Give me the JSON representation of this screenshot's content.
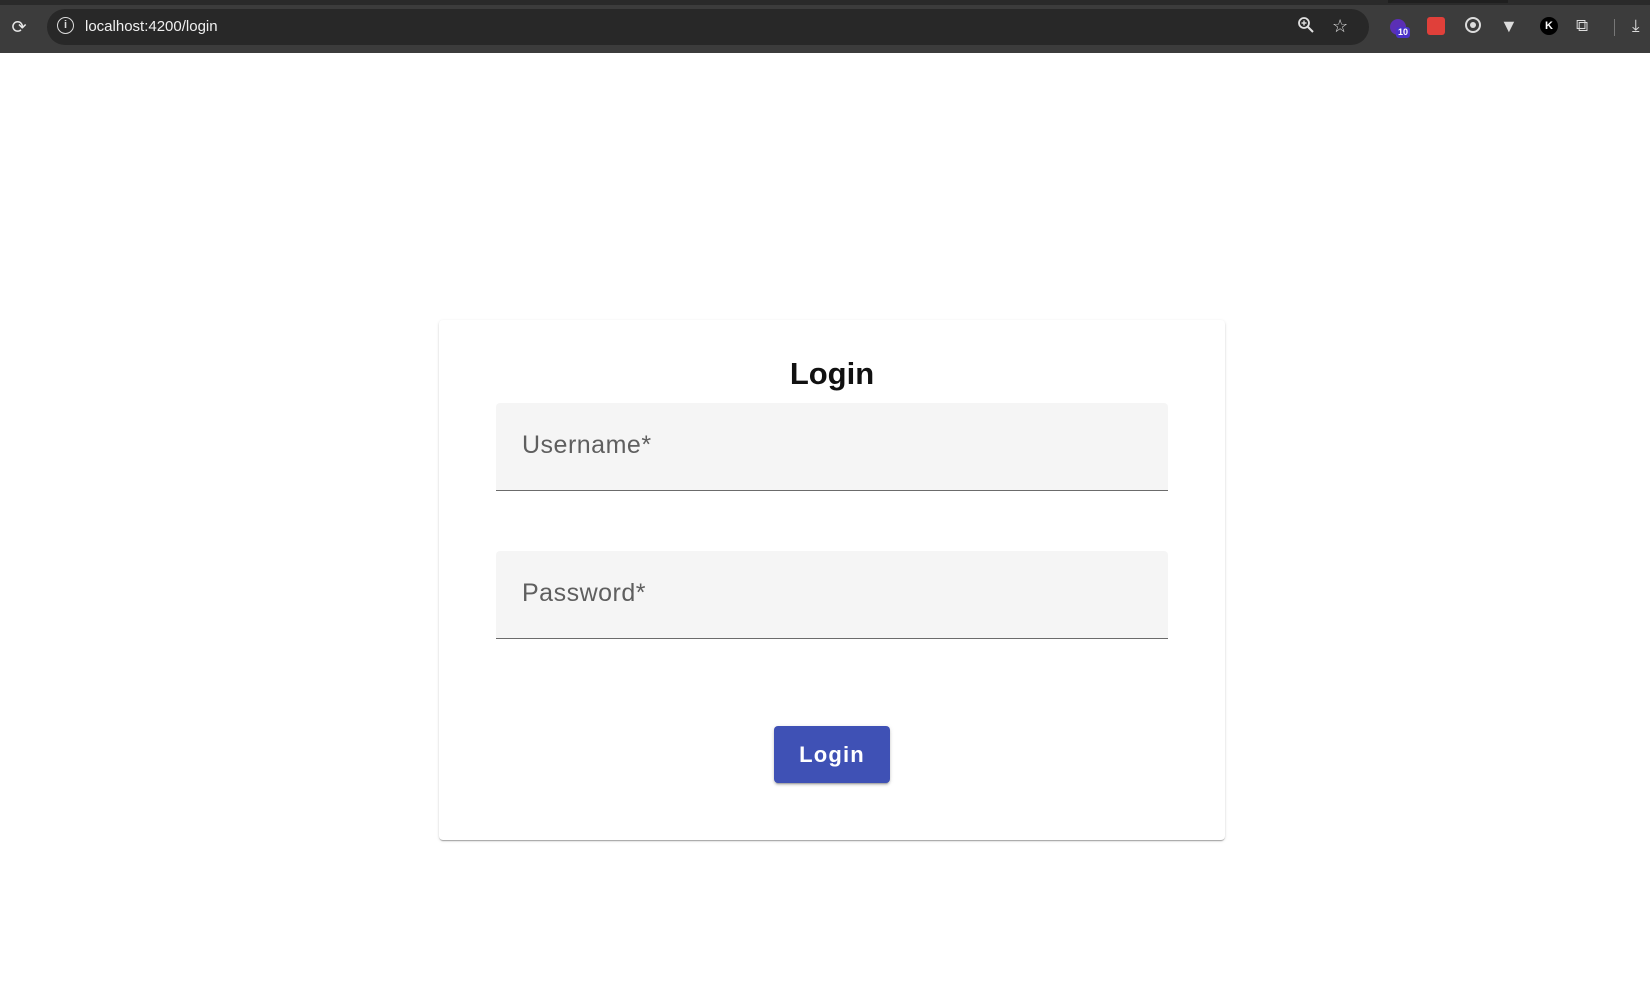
{
  "browser": {
    "url": "localhost:4200/login",
    "icons": {
      "reload": "reload-icon",
      "site_info": "info-icon",
      "zoom": "zoom-icon",
      "bookmark": "star-icon",
      "extensions": "puzzle-icon",
      "download": "download-icon"
    },
    "extension_badge": "10"
  },
  "login_card": {
    "title": "Login",
    "username_label": "Username*",
    "password_label": "Password*",
    "submit_label": "Login"
  },
  "colors": {
    "primary": "#3f51b5",
    "field_background": "#f5f5f5"
  }
}
